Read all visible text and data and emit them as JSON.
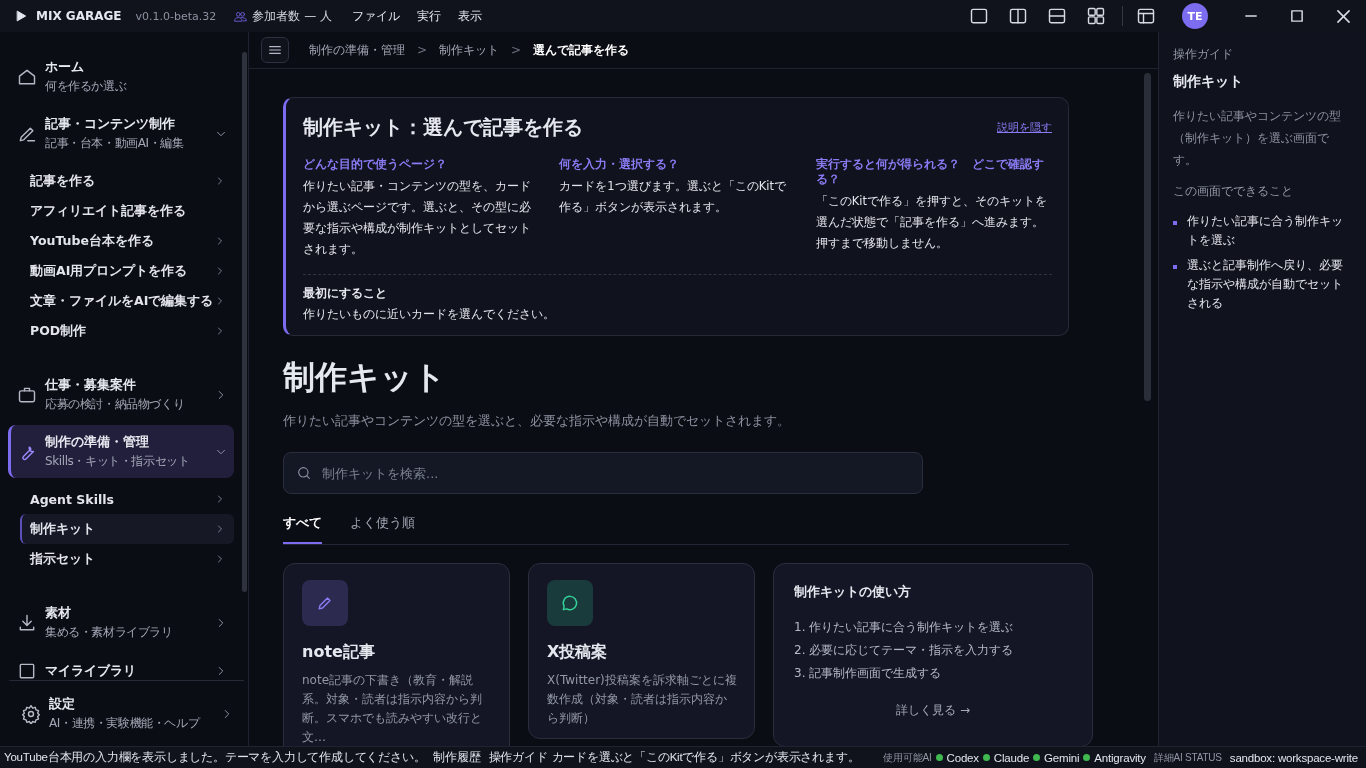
{
  "titlebar": {
    "app_name": "MIX GARAGE",
    "version": "v0.1.0-beta.32",
    "participants": "参加者数 — 人",
    "menus": [
      "ファイル",
      "実行",
      "表示"
    ],
    "layout_buttons": [
      {
        "kind": "single"
      },
      {
        "kind": "columns"
      },
      {
        "kind": "rows"
      },
      {
        "kind": "grid"
      },
      {
        "kind": "panel"
      }
    ],
    "avatar": "TE"
  },
  "sidebar": {
    "groups": [
      {
        "label": "ホーム",
        "sub": "何を作るか選ぶ",
        "kind": "link",
        "selected": false
      },
      {
        "label": "記事・コンテンツ制作",
        "sub": "記事・台本・動画AI・編集",
        "kind": "group",
        "expanded": true,
        "selected": false,
        "children": [
          {
            "label": "記事を作る",
            "arrow": true,
            "selected": false
          },
          {
            "label": "アフィリエイト記事を作る",
            "arrow": false,
            "selected": false
          },
          {
            "label": "YouTube台本を作る",
            "arrow": true,
            "selected": false
          },
          {
            "label": "動画AI用プロンプトを作る",
            "arrow": true,
            "selected": false
          },
          {
            "label": "文章・ファイルをAIで編集する",
            "arrow": true,
            "selected": false
          },
          {
            "label": "POD制作",
            "arrow": true,
            "selected": false
          }
        ]
      },
      {
        "label": "仕事・募集案件",
        "sub": "応募の検討・納品物づくり",
        "kind": "group",
        "expanded": false,
        "selected": false
      },
      {
        "label": "制作の準備・管理",
        "sub": "Skills・キット・指示セット",
        "kind": "group",
        "expanded": true,
        "selected": true,
        "children": [
          {
            "label": "Agent Skills",
            "arrow": true,
            "selected": false
          },
          {
            "label": "制作キット",
            "arrow": true,
            "selected": true
          },
          {
            "label": "指示セット",
            "arrow": true,
            "selected": false
          }
        ]
      },
      {
        "label": "素材",
        "sub": "集める・素材ライブラリ",
        "kind": "group",
        "expanded": false,
        "selected": false
      },
      {
        "label": "マイライブラリ",
        "kind": "group",
        "expanded": false,
        "selected": false
      }
    ],
    "footer": {
      "label": "設定",
      "sub": "AI・連携・実験機能・ヘルプ"
    }
  },
  "breadcrumb": [
    "制作の準備・管理",
    "制作キット",
    "選んで記事を作る"
  ],
  "breadcrumb_separators": [
    ">",
    ">"
  ],
  "info_box": {
    "title": "制作キット：選んで記事を作る",
    "hide_link": "説明を隠す",
    "columns": [
      {
        "heading": "どんな目的で使うページ？",
        "text": "作りたい記事・コンテンツの型を、カードから選ぶページです。選ぶと、その型に必要な指示や構成が制作キットとしてセットされます。"
      },
      {
        "heading": "何を入力・選択する？",
        "text": "カードを1つ選びます。選ぶと「このKitで作る」ボタンが表示されます。"
      },
      {
        "heading": "実行すると何が得られる？　どこで確認する？",
        "text": "「このKitで作る」を押すと、そのキットを選んだ状態で「記事を作る」へ進みます。押すまで移動しません。"
      }
    ],
    "first_heading": "最初にすること",
    "first_text": "作りたいものに近いカードを選んでください。"
  },
  "page": {
    "title": "制作キット",
    "subtitle": "作りたい記事やコンテンツの型を選ぶと、必要な指示や構成が自動でセットされます。",
    "search": {
      "placeholder": "制作キットを検索..."
    },
    "tabs": [
      {
        "label": "すべて",
        "selected": true
      },
      {
        "label": "よく使う順",
        "selected": false
      }
    ],
    "cards": [
      {
        "kind": "kit",
        "color": "#8b7cf6",
        "title": "note記事",
        "text": "note記事の下書き（教育・解説系。対象・読者は指示内容から判断。スマホでも読みやすい改行と文…"
      },
      {
        "kind": "kit",
        "color": "#34d399",
        "title": "X投稿案",
        "text": "X(Twitter)投稿案を訴求軸ごとに複数作成（対象・読者は指示内容から判断）"
      },
      {
        "kind": "guide",
        "title": "制作キットの使い方",
        "steps": [
          "1. 作りたい記事に合う制作キットを選ぶ",
          "2. 必要に応じてテーマ・指示を入力する",
          "3. 記事制作画面で生成する"
        ],
        "link": "詳しく見る →"
      }
    ]
  },
  "guide_panel": {
    "label": "操作ガイド",
    "title": "制作キット",
    "description": "作りたい記事やコンテンツの型（制作キット）を選ぶ画面です。",
    "section": "この画面でできること",
    "items": [
      "作りたい記事に合う制作キットを選ぶ",
      "選ぶと記事制作へ戻り、必要な指示や構成が自動でセットされる"
    ]
  },
  "status_bar": {
    "message": "YouTube台本用の入力欄を表示しました。テーマを入力して作成してください。",
    "links": [
      "制作履歴",
      "操作ガイド"
    ],
    "hint": "カードを選ぶと「このKitで作る」ボタンが表示されます。",
    "ai_label": "使用可能AI",
    "agents": [
      {
        "name": "Codex",
        "color": "#3fb950"
      },
      {
        "name": "Claude",
        "color": "#3fb950"
      },
      {
        "name": "Gemini",
        "color": "#3fb950"
      },
      {
        "name": "Antigravity",
        "color": "#3fb950"
      }
    ],
    "detail": "詳細AI STATUS",
    "sandbox": "sandbox: workspace-write"
  }
}
